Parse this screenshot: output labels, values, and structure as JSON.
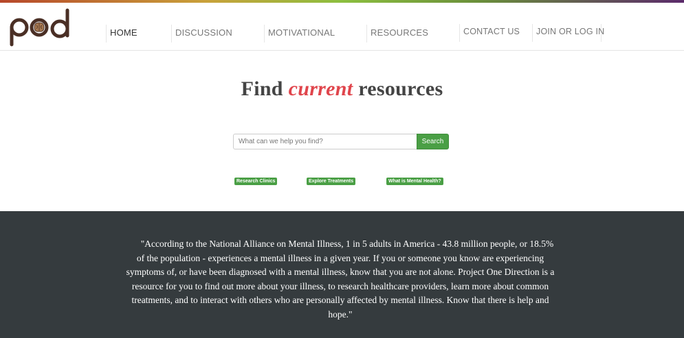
{
  "brand": {
    "logo_text": "pod",
    "stripe_colors": [
      "#b7472a",
      "#c9a13a",
      "#8cbf3f",
      "#6a8f3a",
      "#5b2a6b"
    ],
    "logo_color": "#4a2f25"
  },
  "nav": {
    "items": [
      {
        "label": "HOME",
        "active": true
      },
      {
        "label": "DISCUSSION"
      },
      {
        "label": "MOTIVATIONAL"
      },
      {
        "label": "RESOURCES"
      },
      {
        "label": "CONTACT US"
      },
      {
        "label": "JOIN OR LOG IN"
      }
    ]
  },
  "hero": {
    "title_before": "Find ",
    "title_accent": "current",
    "title_after": " resources",
    "accent_color": "#e0454c"
  },
  "search": {
    "placeholder": "What can we help you find?",
    "value": "",
    "button_label": "Search",
    "button_color": "#4a9f45"
  },
  "quick_links": [
    {
      "label": "Research Clinics"
    },
    {
      "label": "Explore Treatments"
    },
    {
      "label": "What is Mental Health?"
    }
  ],
  "quote": {
    "text": "\"According to the National Alliance on Mental Illness, 1 in 5 adults in America - 43.8 million people, or 18.5% of the population - experiences a mental illness in a given year. If you or someone you know are experiencing symptoms of, or have been diagnosed with a mental illness, know that you are not alone. Project One Direction is a resource for you to find out more about your illness, to research healthcare providers, learn more about common treatments, and to interact with others who are personally affected by mental illness. Know that there is help and hope.\"",
    "background_color": "#353b3e"
  }
}
